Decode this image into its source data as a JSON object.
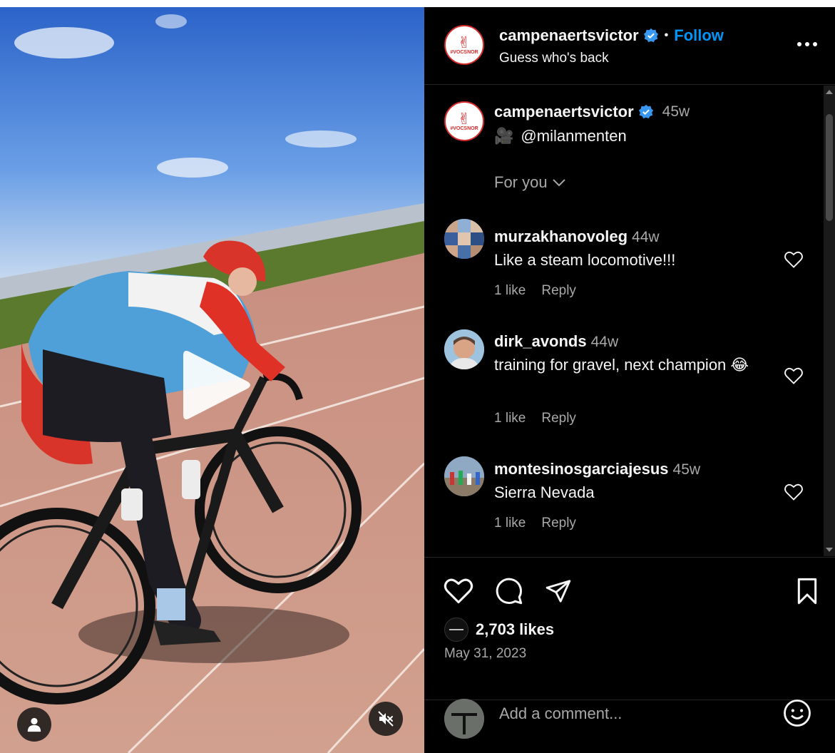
{
  "post": {
    "username": "campenaertsvictor",
    "follow_label": "Follow",
    "subtitle": "Guess who's back",
    "more_icon": "more-horizontal-icon"
  },
  "caption": {
    "username": "campenaertsvictor",
    "time": "45w",
    "emoji": "🎥",
    "text": "@milanmenten"
  },
  "sort": {
    "label": "For you"
  },
  "comments": [
    {
      "username": "murzakhanovoleg",
      "time": "44w",
      "text": "Like a steam locomotive!!!",
      "likes": "1 like",
      "reply": "Reply"
    },
    {
      "username": "dirk_avonds",
      "time": "44w",
      "text": "training for gravel, next champion 😂",
      "likes": "1 like",
      "reply": "Reply"
    },
    {
      "username": "montesinosgarciajesus",
      "time": "45w",
      "text": "Sierra Nevada",
      "likes": "1 like",
      "reply": "Reply"
    }
  ],
  "stats": {
    "likes": "2,703 likes",
    "date": "May 31, 2023"
  },
  "add_comment": {
    "placeholder": "Add a comment..."
  },
  "colors": {
    "link_blue": "#0095f6",
    "muted_text": "#a8a8a8",
    "background": "#000000",
    "avatar_red": "#d42b2b"
  }
}
